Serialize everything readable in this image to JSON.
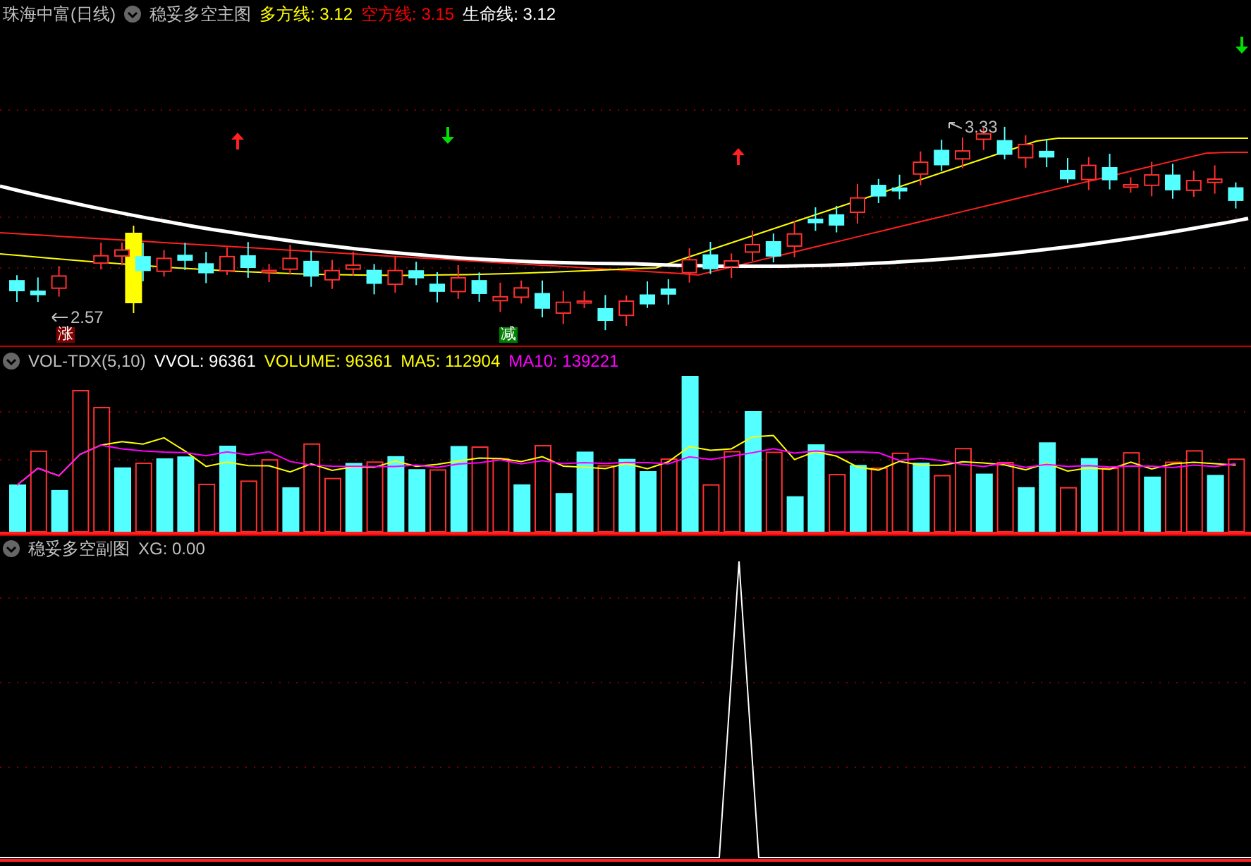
{
  "main_panel": {
    "stock": "珠海中富(日线)",
    "indicator": "稳妥多空主图",
    "lines": [
      {
        "label": "多方线: 3.12",
        "color": "#ffff00"
      },
      {
        "label": "空方线: 3.15",
        "color": "#ff0000"
      },
      {
        "label": "生命线: 3.12",
        "color": "#ffffff"
      }
    ],
    "high_label": "3.33",
    "low_label": "2.57",
    "badges": [
      {
        "text": "涨",
        "kind": "rise"
      },
      {
        "text": "减",
        "kind": "reduce"
      }
    ]
  },
  "volume_panel": {
    "indicator": "VOL-TDX(5,10)",
    "readings": [
      {
        "label": "VVOL: 96361",
        "color": "#ffffff"
      },
      {
        "label": "VOLUME: 96361",
        "color": "#ffff00"
      },
      {
        "label": "MA5: 112904",
        "color": "#ffff00"
      },
      {
        "label": "MA10: 139221",
        "color": "#ff00ff"
      }
    ]
  },
  "sub_panel": {
    "indicator": "稳妥多空副图",
    "reading": "XG: 0.00"
  }
}
